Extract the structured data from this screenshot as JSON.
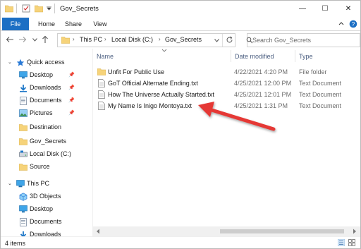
{
  "window": {
    "title": "Gov_Secrets",
    "controls": {
      "minimize": "—",
      "maximize": "☐",
      "close": "✕"
    }
  },
  "ribbon": {
    "tabs": [
      "File",
      "Home",
      "Share",
      "View"
    ]
  },
  "address": {
    "breadcrumbs": [
      "This PC",
      "Local Disk (C:)",
      "Gov_Secrets"
    ],
    "search_placeholder": "Search Gov_Secrets"
  },
  "nav": {
    "quick_access_label": "Quick access",
    "quick_access": [
      {
        "label": "Desktop",
        "icon": "desktop-icon",
        "pinned": true
      },
      {
        "label": "Downloads",
        "icon": "downloads-icon",
        "pinned": true
      },
      {
        "label": "Documents",
        "icon": "documents-icon",
        "pinned": true
      },
      {
        "label": "Pictures",
        "icon": "pictures-icon",
        "pinned": true
      },
      {
        "label": "Destination",
        "icon": "folder-icon",
        "pinned": false
      },
      {
        "label": "Gov_Secrets",
        "icon": "folder-icon",
        "pinned": false
      },
      {
        "label": "Local Disk (C:)",
        "icon": "disk-icon",
        "pinned": false
      },
      {
        "label": "Source",
        "icon": "folder-icon",
        "pinned": false
      }
    ],
    "this_pc_label": "This PC",
    "this_pc": [
      {
        "label": "3D Objects",
        "icon": "3d-objects-icon"
      },
      {
        "label": "Desktop",
        "icon": "desktop-icon"
      },
      {
        "label": "Documents",
        "icon": "documents-icon"
      },
      {
        "label": "Downloads",
        "icon": "downloads-icon"
      }
    ]
  },
  "columns": {
    "name": "Name",
    "date": "Date modified",
    "type": "Type"
  },
  "files": [
    {
      "name": "Unfit For Public Use",
      "date": "4/22/2021 4:20 PM",
      "type": "File folder",
      "icon": "folder-icon"
    },
    {
      "name": "GoT Official Alternate Ending.txt",
      "date": "4/25/2021 12:00 PM",
      "type": "Text Document",
      "icon": "text-file-icon"
    },
    {
      "name": "How The Universe Actually Started.txt",
      "date": "4/25/2021 12:01 PM",
      "type": "Text Document",
      "icon": "text-file-icon"
    },
    {
      "name": "My Name Is Inigo Montoya.txt",
      "date": "4/25/2021 1:31 PM",
      "type": "Text Document",
      "icon": "text-file-icon"
    }
  ],
  "status": {
    "item_count": "4 items"
  },
  "colors": {
    "file_tab": "#1c6fc4",
    "folder": "#f6d37a",
    "annotation_arrow": "#e53935"
  }
}
